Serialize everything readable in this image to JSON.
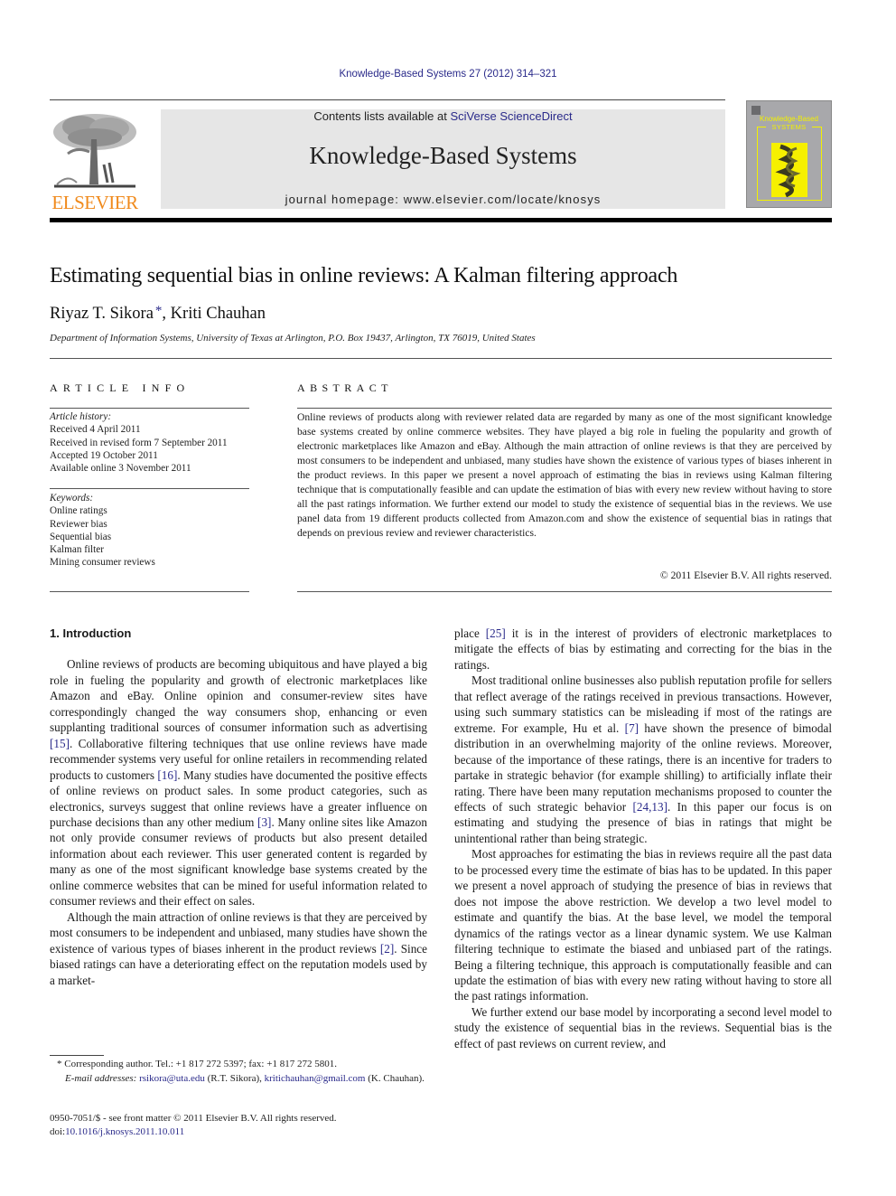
{
  "header": {
    "citation": "Knowledge-Based Systems 27 (2012) 314–321",
    "contents_prefix": "Contents lists available at ",
    "contents_link": "SciVerse ScienceDirect",
    "journal_name": "Knowledge-Based Systems",
    "homepage": "journal homepage: www.elsevier.com/locate/knosys",
    "publisher_logo_text": "ELSEVIER",
    "cover": {
      "title_line1": "Knowledge-Based",
      "title_line2": "SYSTEMS"
    }
  },
  "article": {
    "title": "Estimating sequential bias in online reviews: A Kalman filtering approach",
    "author1": "Riyaz T. Sikora",
    "author_mark": "*",
    "author_sep": ", ",
    "author2": "Kriti Chauhan",
    "affiliation": "Department of Information Systems, University of Texas at Arlington, P.O. Box 19437, Arlington, TX 76019, United States"
  },
  "article_info": {
    "heading": "ARTICLE INFO",
    "history_label": "Article history:",
    "history": [
      "Received 4 April 2011",
      "Received in revised form 7 September 2011",
      "Accepted 19 October 2011",
      "Available online 3 November 2011"
    ],
    "keywords_label": "Keywords:",
    "keywords": [
      "Online ratings",
      "Reviewer bias",
      "Sequential bias",
      "Kalman filter",
      "Mining consumer reviews"
    ]
  },
  "abstract": {
    "heading": "ABSTRACT",
    "text": "Online reviews of products along with reviewer related data are regarded by many as one of the most significant knowledge base systems created by online commerce websites. They have played a big role in fueling the popularity and growth of electronic marketplaces like Amazon and eBay. Although the main attraction of online reviews is that they are perceived by most consumers to be independent and unbiased, many studies have shown the existence of various types of biases inherent in the product reviews. In this paper we present a novel approach of estimating the bias in reviews using Kalman filtering technique that is computationally feasible and can update the estimation of bias with every new review without having to store all the past ratings information. We further extend our model to study the existence of sequential bias in the reviews. We use panel data from 19 different products collected from Amazon.com and show the existence of sequential bias in ratings that depends on previous review and reviewer characteristics.",
    "copyright": "© 2011 Elsevier B.V. All rights reserved."
  },
  "body": {
    "section_heading": "1. Introduction",
    "left": {
      "p1_a": "Online reviews of products are becoming ubiquitous and have played a big role in fueling the popularity and growth of electronic marketplaces like Amazon and eBay. Online opinion and consumer-review sites have correspondingly changed the way consumers shop, enhancing or even supplanting traditional sources of consumer information such as advertising ",
      "p1_ref1": "[15]",
      "p1_b": ". Collaborative filtering techniques that use online reviews have made recommender systems very useful for online retailers in recommending related products to customers ",
      "p1_ref2": "[16]",
      "p1_c": ". Many studies have documented the positive effects of online reviews on product sales. In some product categories, such as electronics, surveys suggest that online reviews have a greater influence on purchase decisions than any other medium ",
      "p1_ref3": "[3]",
      "p1_d": ". Many online sites like Amazon not only provide consumer reviews of products but also present detailed information about each reviewer. This user generated content is regarded by many as one of the most significant knowledge base systems created by the online commerce websites that can be mined for useful information related to consumer reviews and their effect on sales.",
      "p2_a": "Although the main attraction of online reviews is that they are perceived by most consumers to be independent and unbiased, many studies have shown the existence of various types of biases inherent in the product reviews ",
      "p2_ref1": "[2]",
      "p2_b": ". Since biased ratings can have a deteriorating effect on the reputation models used by a market-"
    },
    "right": {
      "p1_a": "place ",
      "p1_ref1": "[25]",
      "p1_b": " it is in the interest of providers of electronic marketplaces to mitigate the effects of bias by estimating and correcting for the bias in the ratings.",
      "p2_a": "Most traditional online businesses also publish reputation profile for sellers that reflect average of the ratings received in previous transactions. However, using such summary statistics can be misleading if most of the ratings are extreme. For example, Hu et al. ",
      "p2_ref1": "[7]",
      "p2_b": " have shown the presence of bimodal distribution in an overwhelming majority of the online reviews. Moreover, because of the importance of these ratings, there is an incentive for traders to partake in strategic behavior (for example shilling) to artificially inflate their rating. There have been many reputation mechanisms proposed to counter the effects of such strategic behavior ",
      "p2_ref2": "[24,13]",
      "p2_c": ". In this paper our focus is on estimating and studying the presence of bias in ratings that might be unintentional rather than being strategic.",
      "p3": "Most approaches for estimating the bias in reviews require all the past data to be processed every time the estimate of bias has to be updated. In this paper we present a novel approach of studying the presence of bias in reviews that does not impose the above restriction. We develop a two level model to estimate and quantify the bias. At the base level, we model the temporal dynamics of the ratings vector as a linear dynamic system. We use Kalman filtering technique to estimate the biased and unbiased part of the ratings. Being a filtering technique, this approach is computationally feasible and can update the estimation of bias with every new rating without having to store all the past ratings information.",
      "p4": "We further extend our base model by incorporating a second level model to study the existence of sequential bias in the reviews. Sequential bias is the effect of past reviews on current review, and"
    }
  },
  "footnotes": {
    "corresponding": "* Corresponding author. Tel.: +1 817 272 5397; fax: +1 817 272 5801.",
    "email_label": "E-mail addresses:",
    "email1": "rsikora@uta.edu",
    "email1_name": " (R.T. Sikora), ",
    "email2": "kritichauhan@gmail.com",
    "email2_name": " (K. Chauhan).",
    "issn_line": "0950-7051/$ - see front matter © 2011 Elsevier B.V. All rights reserved.",
    "doi_prefix": "doi:",
    "doi": "10.1016/j.knosys.2011.10.011"
  },
  "colors": {
    "link": "#2a2a8a",
    "elsevier_orange": "#f08a1c",
    "masthead_bg": "#e6e6e6",
    "cover_bg": "#a8a8ab",
    "cover_yellow": "#f2f000"
  }
}
